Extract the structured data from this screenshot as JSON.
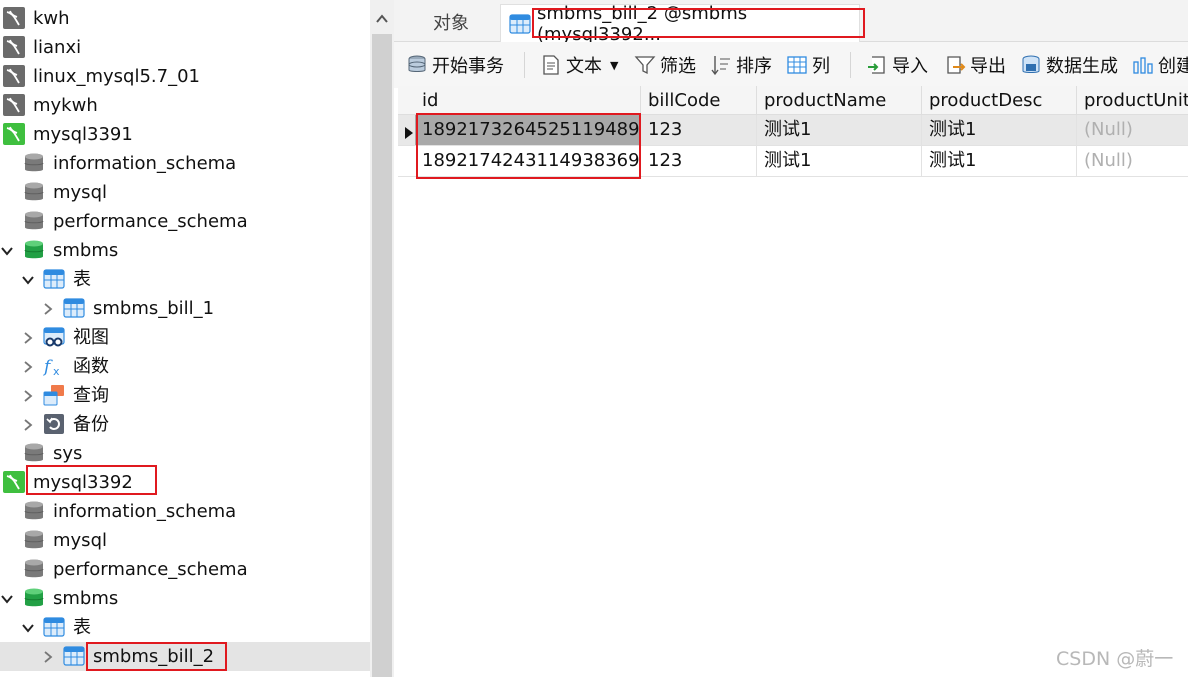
{
  "nav": {
    "items": [
      {
        "label": "kwh",
        "icon": "mysql-connection-closed-icon"
      },
      {
        "label": "lianxi",
        "icon": "mysql-connection-closed-icon"
      },
      {
        "label": "linux_mysql5.7_01",
        "icon": "mysql-connection-closed-icon"
      },
      {
        "label": "mykwh",
        "icon": "mysql-connection-closed-icon"
      },
      {
        "label": "mysql3391",
        "icon": "mysql-connection-open-icon"
      },
      {
        "label": "information_schema",
        "icon": "database-icon"
      },
      {
        "label": "mysql",
        "icon": "database-icon"
      },
      {
        "label": "performance_schema",
        "icon": "database-icon"
      },
      {
        "label": "smbms",
        "icon": "database-open-icon"
      },
      {
        "label": "表",
        "icon": "tables-folder-icon"
      },
      {
        "label": "smbms_bill_1",
        "icon": "table-icon"
      },
      {
        "label": "视图",
        "icon": "views-icon"
      },
      {
        "label": "函数",
        "icon": "functions-icon"
      },
      {
        "label": "查询",
        "icon": "queries-icon"
      },
      {
        "label": "备份",
        "icon": "backups-icon"
      },
      {
        "label": "sys",
        "icon": "database-icon"
      },
      {
        "label": "mysql3392",
        "icon": "mysql-connection-open-icon"
      },
      {
        "label": "information_schema",
        "icon": "database-icon"
      },
      {
        "label": "mysql",
        "icon": "database-icon"
      },
      {
        "label": "performance_schema",
        "icon": "database-icon"
      },
      {
        "label": "smbms",
        "icon": "database-open-icon"
      },
      {
        "label": "表",
        "icon": "tables-folder-icon"
      },
      {
        "label": "smbms_bill_2",
        "icon": "table-icon"
      }
    ]
  },
  "tabs": {
    "objects_label": "对象",
    "active_label": "smbms_bill_2 @smbms (mysql3392..."
  },
  "toolbar": {
    "begin_transaction": "开始事务",
    "text": "文本",
    "filter": "筛选",
    "sort": "排序",
    "columns": "列",
    "import": "导入",
    "export": "导出",
    "generate_data": "数据生成",
    "create": "创建"
  },
  "grid": {
    "columns": [
      "id",
      "billCode",
      "productName",
      "productDesc",
      "productUnit"
    ],
    "rows": [
      [
        "1892173264525119489",
        "123",
        "测试1",
        "测试1",
        "(Null)"
      ],
      [
        "1892174243114938369",
        "123",
        "测试1",
        "测试1",
        "(Null)"
      ]
    ]
  },
  "watermark": "CSDN @蔚一",
  "colors": {
    "highlight": "#e0191f",
    "mysql_green": "#3fbf3f",
    "mysql_gray": "#6b6b6b",
    "table_blue": "#2f8be0",
    "db_gray": "#7a7a7a",
    "db_green": "#28a745"
  }
}
